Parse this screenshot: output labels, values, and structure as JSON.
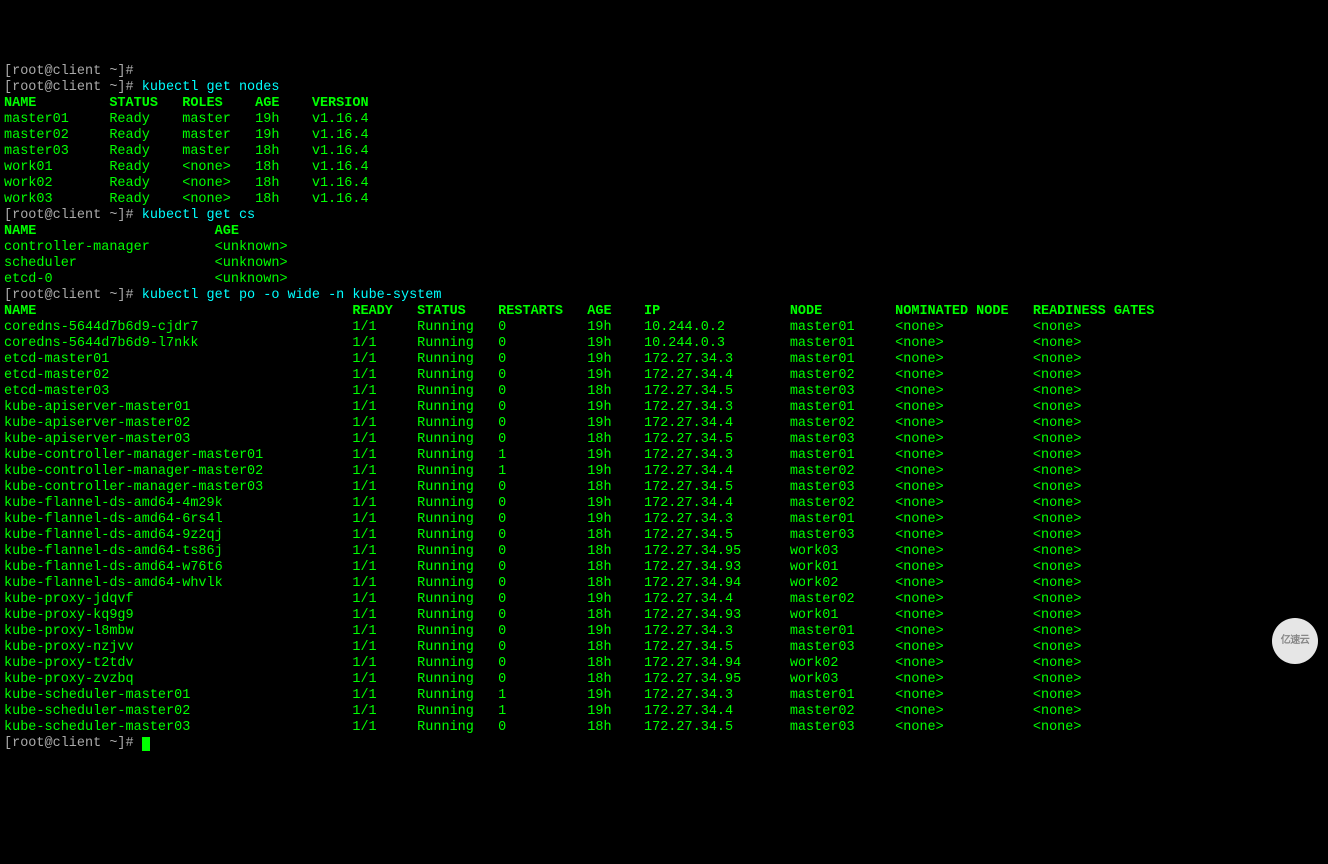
{
  "line0": "[root@client ~]# ",
  "prompt": "[root@client ~]# ",
  "cmd_nodes": "kubectl get nodes",
  "nodes_header": {
    "name": "NAME",
    "status": "STATUS",
    "roles": "ROLES",
    "age": "AGE",
    "version": "VERSION"
  },
  "nodes": [
    {
      "name": "master01",
      "status": "Ready",
      "roles": "master",
      "age": "19h",
      "version": "v1.16.4"
    },
    {
      "name": "master02",
      "status": "Ready",
      "roles": "master",
      "age": "19h",
      "version": "v1.16.4"
    },
    {
      "name": "master03",
      "status": "Ready",
      "roles": "master",
      "age": "18h",
      "version": "v1.16.4"
    },
    {
      "name": "work01",
      "status": "Ready",
      "roles": "<none>",
      "age": "18h",
      "version": "v1.16.4"
    },
    {
      "name": "work02",
      "status": "Ready",
      "roles": "<none>",
      "age": "18h",
      "version": "v1.16.4"
    },
    {
      "name": "work03",
      "status": "Ready",
      "roles": "<none>",
      "age": "18h",
      "version": "v1.16.4"
    }
  ],
  "cmd_cs": "kubectl get cs",
  "cs_header": {
    "name": "NAME",
    "age": "AGE"
  },
  "cs": [
    {
      "name": "controller-manager",
      "age": "<unknown>"
    },
    {
      "name": "scheduler",
      "age": "<unknown>"
    },
    {
      "name": "etcd-0",
      "age": "<unknown>"
    }
  ],
  "cmd_pods": "kubectl get po -o wide -n kube-system",
  "pods_header": {
    "name": "NAME",
    "ready": "READY",
    "status": "STATUS",
    "restarts": "RESTARTS",
    "age": "AGE",
    "ip": "IP",
    "node": "NODE",
    "nominated": "NOMINATED NODE",
    "readiness": "READINESS GATES"
  },
  "pods": [
    {
      "name": "coredns-5644d7b6d9-cjdr7",
      "ready": "1/1",
      "status": "Running",
      "restarts": "0",
      "age": "19h",
      "ip": "10.244.0.2",
      "node": "master01",
      "nominated": "<none>",
      "readiness": "<none>"
    },
    {
      "name": "coredns-5644d7b6d9-l7nkk",
      "ready": "1/1",
      "status": "Running",
      "restarts": "0",
      "age": "19h",
      "ip": "10.244.0.3",
      "node": "master01",
      "nominated": "<none>",
      "readiness": "<none>"
    },
    {
      "name": "etcd-master01",
      "ready": "1/1",
      "status": "Running",
      "restarts": "0",
      "age": "19h",
      "ip": "172.27.34.3",
      "node": "master01",
      "nominated": "<none>",
      "readiness": "<none>"
    },
    {
      "name": "etcd-master02",
      "ready": "1/1",
      "status": "Running",
      "restarts": "0",
      "age": "19h",
      "ip": "172.27.34.4",
      "node": "master02",
      "nominated": "<none>",
      "readiness": "<none>"
    },
    {
      "name": "etcd-master03",
      "ready": "1/1",
      "status": "Running",
      "restarts": "0",
      "age": "18h",
      "ip": "172.27.34.5",
      "node": "master03",
      "nominated": "<none>",
      "readiness": "<none>"
    },
    {
      "name": "kube-apiserver-master01",
      "ready": "1/1",
      "status": "Running",
      "restarts": "0",
      "age": "19h",
      "ip": "172.27.34.3",
      "node": "master01",
      "nominated": "<none>",
      "readiness": "<none>"
    },
    {
      "name": "kube-apiserver-master02",
      "ready": "1/1",
      "status": "Running",
      "restarts": "0",
      "age": "19h",
      "ip": "172.27.34.4",
      "node": "master02",
      "nominated": "<none>",
      "readiness": "<none>"
    },
    {
      "name": "kube-apiserver-master03",
      "ready": "1/1",
      "status": "Running",
      "restarts": "0",
      "age": "18h",
      "ip": "172.27.34.5",
      "node": "master03",
      "nominated": "<none>",
      "readiness": "<none>"
    },
    {
      "name": "kube-controller-manager-master01",
      "ready": "1/1",
      "status": "Running",
      "restarts": "1",
      "age": "19h",
      "ip": "172.27.34.3",
      "node": "master01",
      "nominated": "<none>",
      "readiness": "<none>"
    },
    {
      "name": "kube-controller-manager-master02",
      "ready": "1/1",
      "status": "Running",
      "restarts": "1",
      "age": "19h",
      "ip": "172.27.34.4",
      "node": "master02",
      "nominated": "<none>",
      "readiness": "<none>"
    },
    {
      "name": "kube-controller-manager-master03",
      "ready": "1/1",
      "status": "Running",
      "restarts": "0",
      "age": "18h",
      "ip": "172.27.34.5",
      "node": "master03",
      "nominated": "<none>",
      "readiness": "<none>"
    },
    {
      "name": "kube-flannel-ds-amd64-4m29k",
      "ready": "1/1",
      "status": "Running",
      "restarts": "0",
      "age": "19h",
      "ip": "172.27.34.4",
      "node": "master02",
      "nominated": "<none>",
      "readiness": "<none>"
    },
    {
      "name": "kube-flannel-ds-amd64-6rs4l",
      "ready": "1/1",
      "status": "Running",
      "restarts": "0",
      "age": "19h",
      "ip": "172.27.34.3",
      "node": "master01",
      "nominated": "<none>",
      "readiness": "<none>"
    },
    {
      "name": "kube-flannel-ds-amd64-9z2qj",
      "ready": "1/1",
      "status": "Running",
      "restarts": "0",
      "age": "18h",
      "ip": "172.27.34.5",
      "node": "master03",
      "nominated": "<none>",
      "readiness": "<none>"
    },
    {
      "name": "kube-flannel-ds-amd64-ts86j",
      "ready": "1/1",
      "status": "Running",
      "restarts": "0",
      "age": "18h",
      "ip": "172.27.34.95",
      "node": "work03",
      "nominated": "<none>",
      "readiness": "<none>"
    },
    {
      "name": "kube-flannel-ds-amd64-w76t6",
      "ready": "1/1",
      "status": "Running",
      "restarts": "0",
      "age": "18h",
      "ip": "172.27.34.93",
      "node": "work01",
      "nominated": "<none>",
      "readiness": "<none>"
    },
    {
      "name": "kube-flannel-ds-amd64-whvlk",
      "ready": "1/1",
      "status": "Running",
      "restarts": "0",
      "age": "18h",
      "ip": "172.27.34.94",
      "node": "work02",
      "nominated": "<none>",
      "readiness": "<none>"
    },
    {
      "name": "kube-proxy-jdqvf",
      "ready": "1/1",
      "status": "Running",
      "restarts": "0",
      "age": "19h",
      "ip": "172.27.34.4",
      "node": "master02",
      "nominated": "<none>",
      "readiness": "<none>"
    },
    {
      "name": "kube-proxy-kq9g9",
      "ready": "1/1",
      "status": "Running",
      "restarts": "0",
      "age": "18h",
      "ip": "172.27.34.93",
      "node": "work01",
      "nominated": "<none>",
      "readiness": "<none>"
    },
    {
      "name": "kube-proxy-l8mbw",
      "ready": "1/1",
      "status": "Running",
      "restarts": "0",
      "age": "19h",
      "ip": "172.27.34.3",
      "node": "master01",
      "nominated": "<none>",
      "readiness": "<none>"
    },
    {
      "name": "kube-proxy-nzjvv",
      "ready": "1/1",
      "status": "Running",
      "restarts": "0",
      "age": "18h",
      "ip": "172.27.34.5",
      "node": "master03",
      "nominated": "<none>",
      "readiness": "<none>"
    },
    {
      "name": "kube-proxy-t2tdv",
      "ready": "1/1",
      "status": "Running",
      "restarts": "0",
      "age": "18h",
      "ip": "172.27.34.94",
      "node": "work02",
      "nominated": "<none>",
      "readiness": "<none>"
    },
    {
      "name": "kube-proxy-zvzbq",
      "ready": "1/1",
      "status": "Running",
      "restarts": "0",
      "age": "18h",
      "ip": "172.27.34.95",
      "node": "work03",
      "nominated": "<none>",
      "readiness": "<none>"
    },
    {
      "name": "kube-scheduler-master01",
      "ready": "1/1",
      "status": "Running",
      "restarts": "1",
      "age": "19h",
      "ip": "172.27.34.3",
      "node": "master01",
      "nominated": "<none>",
      "readiness": "<none>"
    },
    {
      "name": "kube-scheduler-master02",
      "ready": "1/1",
      "status": "Running",
      "restarts": "1",
      "age": "19h",
      "ip": "172.27.34.4",
      "node": "master02",
      "nominated": "<none>",
      "readiness": "<none>"
    },
    {
      "name": "kube-scheduler-master03",
      "ready": "1/1",
      "status": "Running",
      "restarts": "0",
      "age": "18h",
      "ip": "172.27.34.5",
      "node": "master03",
      "nominated": "<none>",
      "readiness": "<none>"
    }
  ],
  "watermark": "亿速云"
}
